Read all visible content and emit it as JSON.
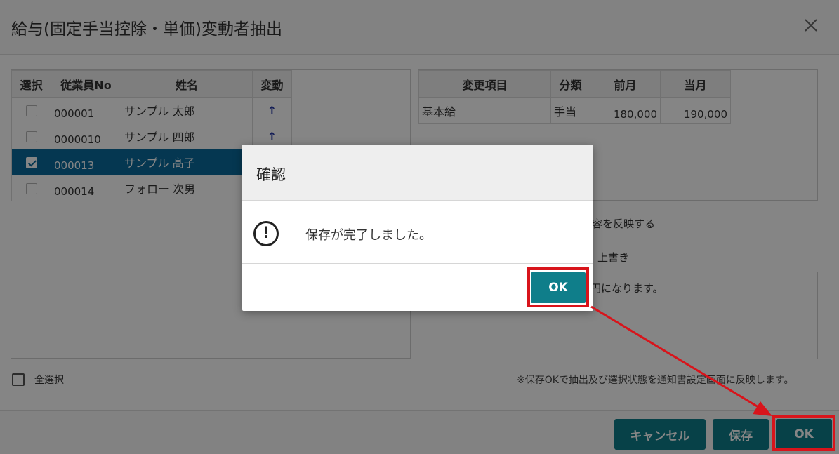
{
  "dialog": {
    "title": "給与(固定手当控除・単価)変動者抽出",
    "close_icon": "close-icon"
  },
  "employee_table": {
    "headers": [
      "選択",
      "従業員No",
      "姓名",
      "変動"
    ],
    "rows": [
      {
        "checked": false,
        "no": "000001",
        "name": "サンプル 太郎",
        "change": "↑",
        "selected": false
      },
      {
        "checked": false,
        "no": "0000010",
        "name": "サンプル 四郎",
        "change": "↑",
        "selected": false
      },
      {
        "checked": true,
        "no": "000013",
        "name": "サンプル 髙子",
        "change": "",
        "selected": true
      },
      {
        "checked": false,
        "no": "000014",
        "name": "フォロー 次男",
        "change": "",
        "selected": false
      }
    ]
  },
  "change_table": {
    "headers": [
      "変更項目",
      "分類",
      "前月",
      "当月"
    ],
    "rows": [
      {
        "item": "基本給",
        "category": "手当",
        "prev": "180,000",
        "curr": "190,000"
      }
    ]
  },
  "right_panel": {
    "reflect_text": "容を反映する",
    "overwrite_label": "上書き",
    "message_text": "円になります。"
  },
  "footer": {
    "select_all_label": "全選択",
    "note": "※保存OKで抽出及び選択状態を通知書設定画面に反映します。",
    "cancel_label": "キャンセル",
    "save_label": "保存",
    "ok_label": "OK"
  },
  "modal": {
    "title": "確認",
    "icon": "alert-circle-icon",
    "message": "保存が完了しました。",
    "ok_label": "OK"
  },
  "colors": {
    "accent": "#0f7e8a",
    "selected_row": "#0b6a9c",
    "highlight": "#d8141b"
  }
}
